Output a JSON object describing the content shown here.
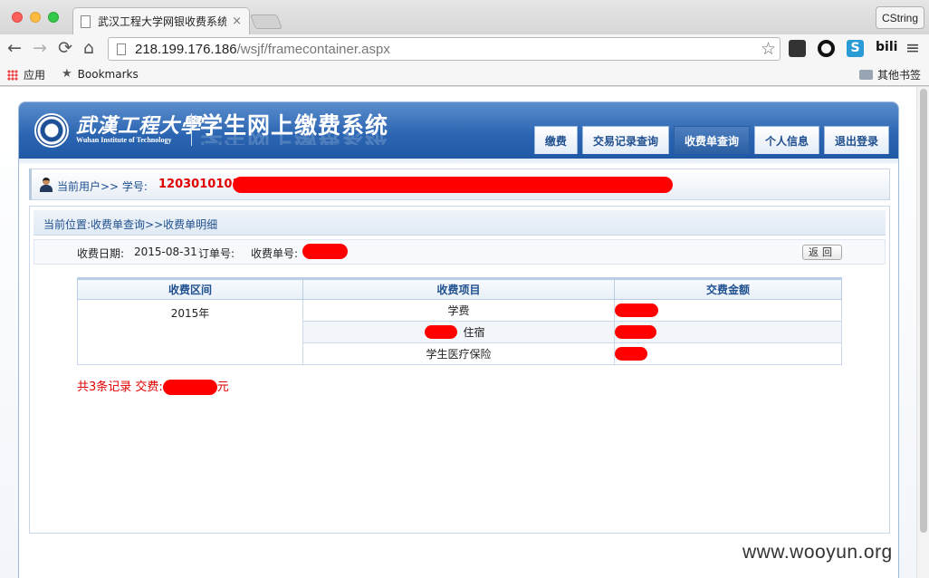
{
  "browser": {
    "tab_title": "武汉工程大学网银收费系统",
    "tab_close": "×",
    "profile_label": "CString",
    "url_host": "218.199.176.186",
    "url_path": "/wsjf/framecontainer.aspx",
    "ext_s_label": "S",
    "ext_bili_label": "bili",
    "bookmarks": {
      "apps_label": "应用",
      "bookmarks_label": "Bookmarks",
      "other_label": "其他书签"
    }
  },
  "site": {
    "logo_cn": "武漢工程大學",
    "logo_en": "Wuhan Institute of Technology",
    "system_title": "学生网上缴费系统",
    "nav": [
      {
        "label": "缴费"
      },
      {
        "label": "交易记录查询"
      },
      {
        "label": "收费单查询"
      },
      {
        "label": "个人信息"
      },
      {
        "label": "退出登录"
      }
    ],
    "active_nav": "收费单查询",
    "userbar": {
      "text": "当前用户>> 学号:",
      "student_id": "1203010101"
    },
    "breadcrumb": "当前位置:收费单查询>>收费单明细",
    "info": {
      "date_label": "收费日期:",
      "date_value": "2015-08-31",
      "order_label": "订单号:",
      "bill_label": "收费单号:",
      "back_button": "返回"
    },
    "table": {
      "headers": [
        "收费区间",
        "收费项目",
        "交费金额"
      ],
      "period": "2015年",
      "rows": [
        {
          "item": "学费"
        },
        {
          "item": "住宿"
        },
        {
          "item": "学生医疗保险"
        }
      ]
    },
    "summary": {
      "prefix": "共3条记录  交费:",
      "suffix": "元"
    }
  },
  "watermark": "www.wooyun.org",
  "colors": {
    "header_blue": "#2d67b3",
    "redaction": "#ff0000",
    "summary_red": "#e00000"
  }
}
